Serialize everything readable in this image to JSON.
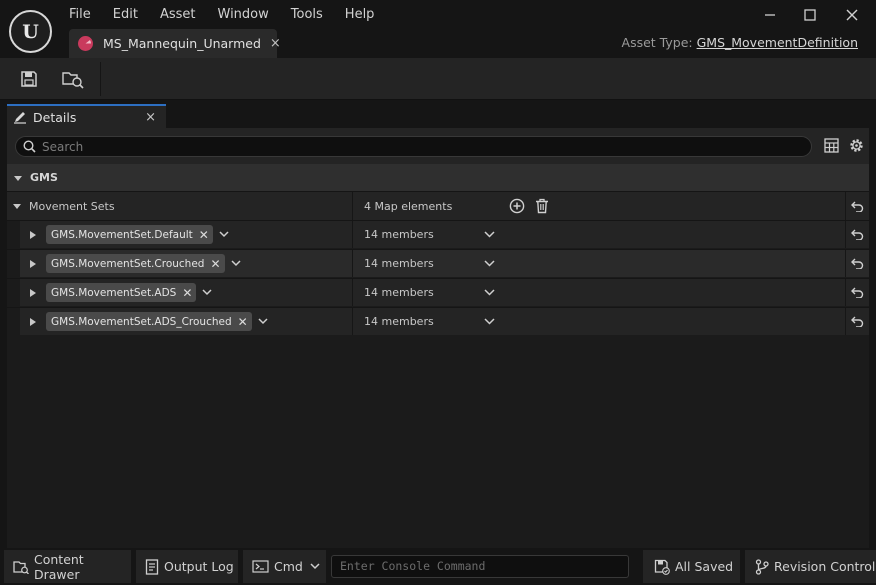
{
  "app": {
    "logo_text": "U"
  },
  "menu": [
    "File",
    "Edit",
    "Asset",
    "Window",
    "Tools",
    "Help"
  ],
  "asset_tab": {
    "label": "MS_Mannequin_Unarmed",
    "close": "×"
  },
  "asset_type": {
    "label": "Asset Type:",
    "value": "GMS_MovementDefinition"
  },
  "details_tab": {
    "label": "Details",
    "close": "×"
  },
  "search": {
    "placeholder": "Search"
  },
  "category": {
    "label": "GMS"
  },
  "movement_sets": {
    "label": "Movement Sets",
    "value": "4 Map elements",
    "entries": [
      {
        "key": "GMS.MovementSet.Default",
        "value": "14 members"
      },
      {
        "key": "GMS.MovementSet.Crouched",
        "value": "14 members"
      },
      {
        "key": "GMS.MovementSet.ADS",
        "value": "14 members"
      },
      {
        "key": "GMS.MovementSet.ADS_Crouched",
        "value": "14 members"
      }
    ]
  },
  "statusbar": {
    "content_drawer": "Content Drawer",
    "output_log": "Output Log",
    "cmd": "Cmd",
    "console_placeholder": "Enter Console Command",
    "all_saved": "All Saved",
    "revision_control": "Revision Control"
  },
  "colors": {
    "accent_blue": "#2d6fc2",
    "asset_icon": "#c93a5d"
  },
  "icons": [
    "unreal-logo-icon",
    "minimize-icon",
    "maximize-icon",
    "close-icon",
    "save-icon",
    "browse-icon",
    "details-pencil-icon",
    "search-icon",
    "table-icon",
    "gear-icon",
    "add-element-icon",
    "delete-icon",
    "reset-icon",
    "expand-arrow-icon",
    "chevron-down-icon",
    "content-drawer-icon",
    "output-log-icon",
    "cmd-icon",
    "all-saved-icon",
    "revision-control-icon"
  ]
}
